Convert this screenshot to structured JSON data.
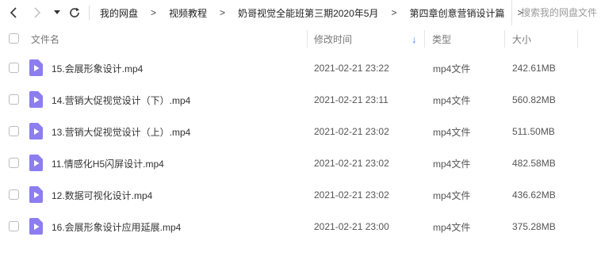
{
  "nav": {
    "breadcrumbs": [
      {
        "label": "我的网盘"
      },
      {
        "label": "视频教程"
      },
      {
        "label": "奶哥视觉全能班第三期2020年5月"
      },
      {
        "label": "第四章创意营销设计篇"
      }
    ],
    "separator": ">",
    "search_placeholder": "搜索我的网盘文件"
  },
  "columns": {
    "name": "文件名",
    "modified": "修改时间",
    "type": "类型",
    "size": "大小",
    "sort_indicator": "↓"
  },
  "files": [
    {
      "name": "15.会展形象设计.mp4",
      "modified": "2021-02-21 23:22",
      "type": "mp4文件",
      "size": "242.61MB"
    },
    {
      "name": "14.营销大促视觉设计（下）.mp4",
      "modified": "2021-02-21 23:11",
      "type": "mp4文件",
      "size": "560.82MB"
    },
    {
      "name": "13.营销大促视觉设计（上）.mp4",
      "modified": "2021-02-21 23:02",
      "type": "mp4文件",
      "size": "511.50MB"
    },
    {
      "name": "11.情感化H5闪屏设计.mp4",
      "modified": "2021-02-21 23:02",
      "type": "mp4文件",
      "size": "482.58MB"
    },
    {
      "name": "12.数据可视化设计.mp4",
      "modified": "2021-02-21 23:02",
      "type": "mp4文件",
      "size": "436.62MB"
    },
    {
      "name": "16.会展形象设计应用延展.mp4",
      "modified": "2021-02-21 23:00",
      "type": "mp4文件",
      "size": "375.28MB"
    }
  ],
  "colors": {
    "video_icon": "#8c7ef0",
    "sort_arrow": "#3b86f0"
  }
}
